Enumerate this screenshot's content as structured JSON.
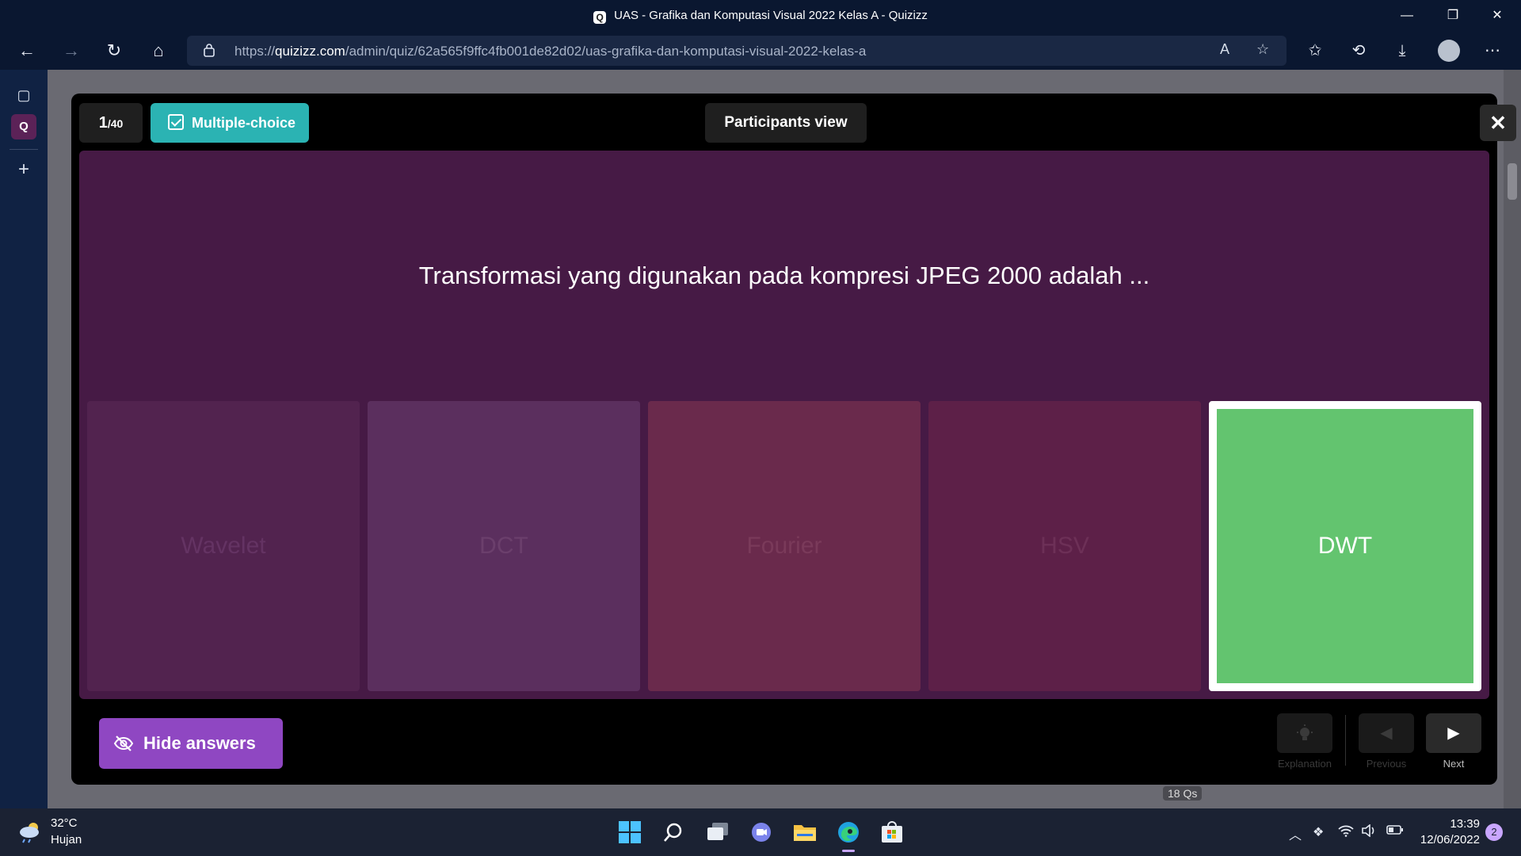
{
  "window": {
    "title": "UAS - Grafika dan Komputasi Visual 2022 Kelas A - Quizizz",
    "favicon_letter": "Q",
    "controls": {
      "minimize": "—",
      "restore": "❐",
      "close": "✕"
    }
  },
  "browser": {
    "url_prefix": "https://",
    "url_domain": "quizizz.com",
    "url_path": "/admin/quiz/62a565f9ffc4fb001de82d02/uas-grafika-dan-komputasi-visual-2022-kelas-a",
    "buttons": {
      "back": "←",
      "forward": "→",
      "refresh": "↻",
      "home": "⌂",
      "read_aloud": "A",
      "add_favorite": "☆",
      "favorites": "✩",
      "history": "⟲",
      "downloads": "⤓",
      "more": "⋯"
    }
  },
  "edge_sidebar": {
    "tabs_icon": "▢",
    "quizizz_tab": "Q",
    "add": "+"
  },
  "background_page": {
    "qs_badge": "18 Qs"
  },
  "quiz_modal": {
    "counter_current": "1",
    "counter_total": "/40",
    "question_type": "Multiple-choice",
    "participants_view_label": "Participants view",
    "close_label": "✕",
    "question_text": "Transformasi yang digunakan pada kompresi JPEG 2000 adalah ...",
    "options": [
      {
        "label": "Wavelet",
        "correct": false,
        "color": "#52234f"
      },
      {
        "label": "DCT",
        "correct": false,
        "color": "#5b2f5e"
      },
      {
        "label": "Fourier",
        "correct": false,
        "color": "#6a2a4c"
      },
      {
        "label": "HSV",
        "correct": false,
        "color": "#5d2048"
      },
      {
        "label": "DWT",
        "correct": true,
        "color": "#63c46f"
      }
    ],
    "hide_answers_label": "Hide answers",
    "explanation_label": "Explanation",
    "previous_label": "Previous",
    "next_label": "Next"
  },
  "taskbar": {
    "temperature": "32°C",
    "weather": "Hujan",
    "time": "13:39",
    "date": "12/06/2022",
    "notifications": "2"
  }
}
